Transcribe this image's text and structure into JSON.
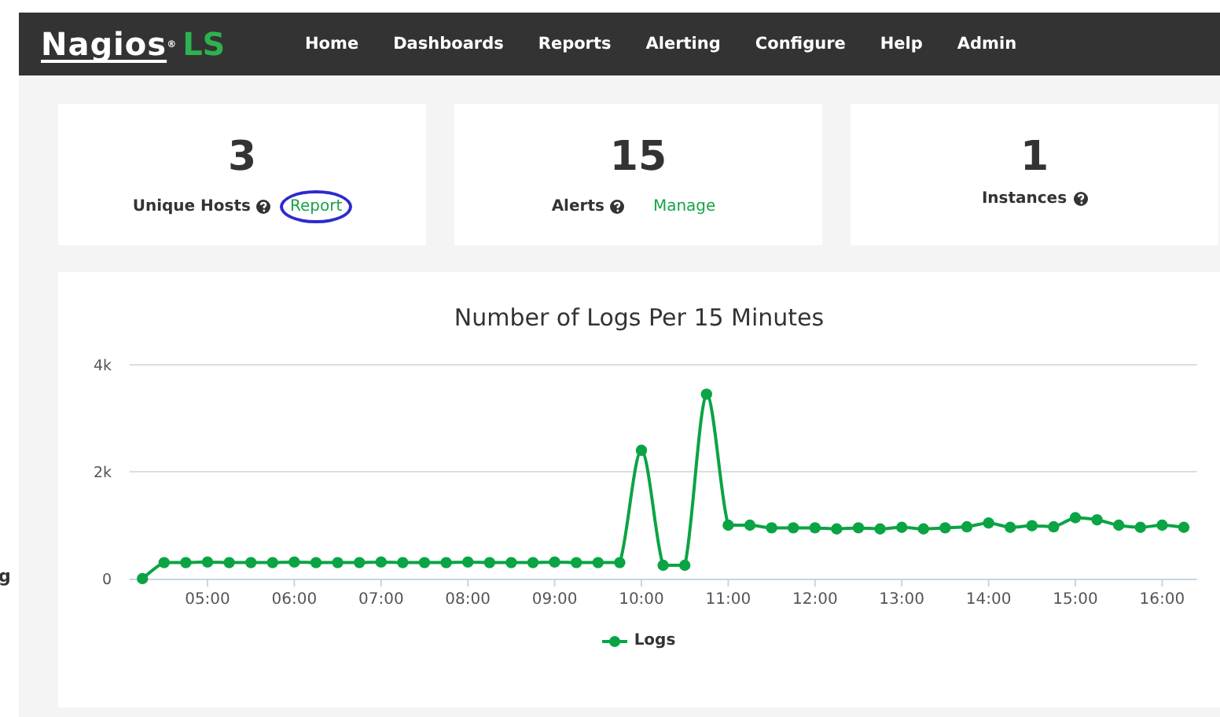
{
  "edge_fragment": "g",
  "nav": {
    "logo": {
      "name": "Nagios",
      "mark": "®",
      "product": "LS"
    },
    "items": [
      {
        "label": "Home"
      },
      {
        "label": "Dashboards"
      },
      {
        "label": "Reports"
      },
      {
        "label": "Alerting"
      },
      {
        "label": "Configure"
      },
      {
        "label": "Help"
      },
      {
        "label": "Admin"
      }
    ]
  },
  "stats": [
    {
      "value": "3",
      "label": "Unique Hosts",
      "link": {
        "label": "Report",
        "circled": true
      }
    },
    {
      "value": "15",
      "label": "Alerts",
      "link": {
        "label": "Manage",
        "circled": false
      }
    },
    {
      "value": "1",
      "label": "Instances"
    }
  ],
  "chart": {
    "chart_data": {
      "type": "line",
      "title": "Number of Logs Per 15 Minutes",
      "x": [
        4.25,
        4.5,
        4.75,
        5,
        5.25,
        5.5,
        5.75,
        6,
        6.25,
        6.5,
        6.75,
        7,
        7.25,
        7.5,
        7.75,
        8,
        8.25,
        8.5,
        8.75,
        9,
        9.25,
        9.5,
        9.75,
        10,
        10.25,
        10.5,
        10.75,
        11,
        11.25,
        11.5,
        11.75,
        12,
        12.25,
        12.5,
        12.75,
        13,
        13.25,
        13.5,
        13.75,
        14,
        14.25,
        14.5,
        14.75,
        15,
        15.25,
        15.5,
        15.75,
        16,
        16.25
      ],
      "series": [
        {
          "name": "Logs",
          "color": "#0aa444",
          "marker": "circle",
          "values": [
            0,
            300,
            300,
            310,
            300,
            300,
            300,
            310,
            300,
            300,
            300,
            310,
            300,
            300,
            300,
            310,
            300,
            300,
            300,
            310,
            300,
            300,
            300,
            2400,
            250,
            250,
            3450,
            1000,
            1000,
            950,
            950,
            950,
            930,
            950,
            930,
            960,
            930,
            950,
            970,
            1040,
            960,
            990,
            970,
            1140,
            1100,
            1000,
            960,
            1000,
            960
          ]
        }
      ],
      "xlim": [
        4.1,
        16.4
      ],
      "ylim": [
        0,
        4000
      ],
      "xticks": [
        {
          "value": 5,
          "label": "05:00"
        },
        {
          "value": 6,
          "label": "06:00"
        },
        {
          "value": 7,
          "label": "07:00"
        },
        {
          "value": 8,
          "label": "08:00"
        },
        {
          "value": 9,
          "label": "09:00"
        },
        {
          "value": 10,
          "label": "10:00"
        },
        {
          "value": 11,
          "label": "11:00"
        },
        {
          "value": 12,
          "label": "12:00"
        },
        {
          "value": 13,
          "label": "13:00"
        },
        {
          "value": 14,
          "label": "14:00"
        },
        {
          "value": 15,
          "label": "15:00"
        },
        {
          "value": 16,
          "label": "16:00"
        }
      ],
      "yticks": [
        {
          "value": 0,
          "label": "0"
        },
        {
          "value": 2000,
          "label": "2k"
        },
        {
          "value": 4000,
          "label": "4k"
        }
      ]
    }
  }
}
